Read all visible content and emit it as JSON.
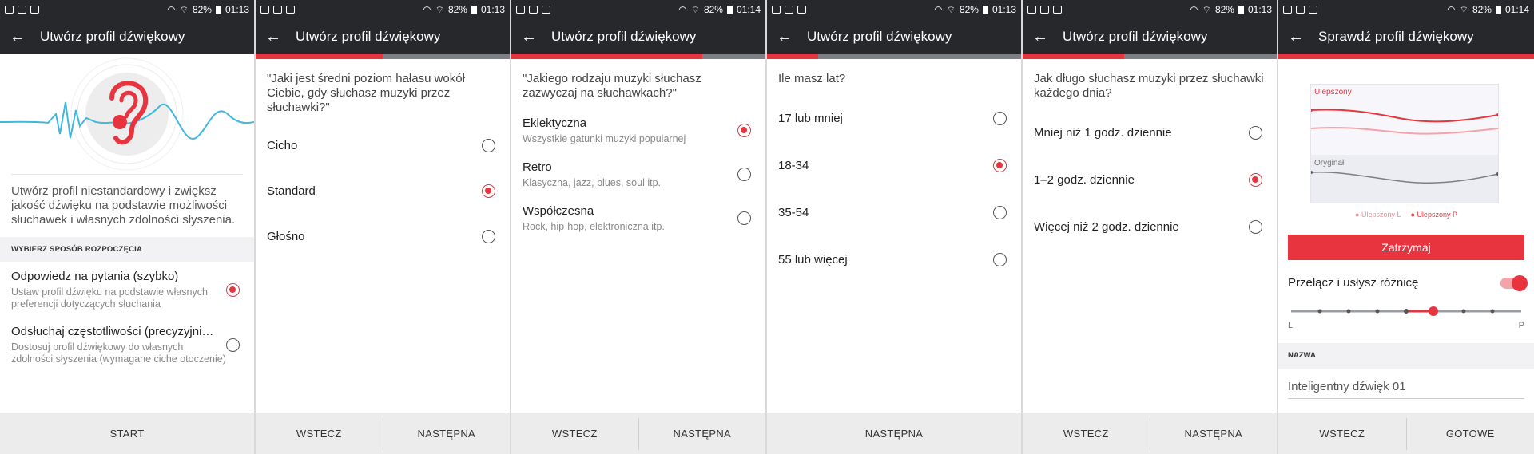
{
  "status": {
    "battery": "82%",
    "times": [
      "01:13",
      "01:13",
      "01:14",
      "01:13",
      "01:13",
      "01:14"
    ]
  },
  "accent_color": "#e8343f",
  "screen1": {
    "title": "Utwórz profil dźwiękowy",
    "description": "Utwórz profil niestandardowy i zwiększ jakość dźwięku na podstawie możliwości słuchawek i własnych zdolności słyszenia.",
    "section_header": "WYBIERZ SPOSÓB ROZPOCZĘCIA",
    "options": [
      {
        "label": "Odpowiedz na pytania (szybko)",
        "sub": "Ustaw profil dźwięku na podstawie własnych preferencji dotyczących słuchania",
        "selected": true
      },
      {
        "label": "Odsłuchaj częstotliwości (precyzyjni…",
        "sub": "Dostosuj profil dźwiękowy do własnych zdolności słyszenia (wymagane ciche otoczenie)",
        "selected": false
      }
    ],
    "footer": [
      "START"
    ],
    "progress": 0
  },
  "screen2": {
    "title": "Utwórz profil dźwiękowy",
    "question": "\"Jaki jest średni poziom hałasu wokół Ciebie, gdy słuchasz muzyki przez słuchawki?\"",
    "options": [
      {
        "label": "Cicho",
        "selected": false
      },
      {
        "label": "Standard",
        "selected": true
      },
      {
        "label": "Głośno",
        "selected": false
      }
    ],
    "footer": [
      "WSTECZ",
      "NASTĘPNA"
    ],
    "progress": 0.5
  },
  "screen3": {
    "title": "Utwórz profil dźwiękowy",
    "question": "\"Jakiego rodzaju muzyki słuchasz zazwyczaj na słuchawkach?\"",
    "options": [
      {
        "label": "Eklektyczna",
        "sub": "Wszystkie gatunki muzyki popularnej",
        "selected": true
      },
      {
        "label": "Retro",
        "sub": "Klasyczna, jazz, blues, soul itp.",
        "selected": false
      },
      {
        "label": "Współczesna",
        "sub": "Rock, hip-hop, elektroniczna itp.",
        "selected": false
      }
    ],
    "footer": [
      "WSTECZ",
      "NASTĘPNA"
    ],
    "progress": 0.75
  },
  "screen4": {
    "title": "Utwórz profil dźwiękowy",
    "question": "Ile masz lat?",
    "options": [
      {
        "label": "17 lub mniej",
        "selected": false
      },
      {
        "label": "18-34",
        "selected": true
      },
      {
        "label": "35-54",
        "selected": false
      },
      {
        "label": "55 lub więcej",
        "selected": false
      }
    ],
    "footer": [
      "NASTĘPNA"
    ],
    "progress": 0.2
  },
  "screen5": {
    "title": "Utwórz profil dźwiękowy",
    "question": "Jak długo słuchasz muzyki przez słuchawki każdego dnia?",
    "options": [
      {
        "label": "Mniej niż 1 godz. dziennie",
        "selected": false
      },
      {
        "label": "1–2 godz. dziennie",
        "selected": true
      },
      {
        "label": "Więcej niż 2 godz. dziennie",
        "selected": false
      }
    ],
    "footer": [
      "WSTECZ",
      "NASTĘPNA"
    ],
    "progress": 0.4
  },
  "screen6": {
    "title": "Sprawdź profil dźwiękowy",
    "chart": {
      "enhanced_label": "Ulepszony",
      "original_label": "Oryginał",
      "legend": [
        "Ulepszony L",
        "Ulepszony P"
      ]
    },
    "stop_button": "Zatrzymaj",
    "toggle_label": "Przełącz i usłysz różnicę",
    "toggle_on": true,
    "slider_left": "L",
    "slider_right": "P",
    "name_header": "NAZWA",
    "name_value": "Inteligentny dźwięk 01",
    "footer": [
      "WSTECZ",
      "GOTOWE"
    ],
    "progress": 1
  }
}
